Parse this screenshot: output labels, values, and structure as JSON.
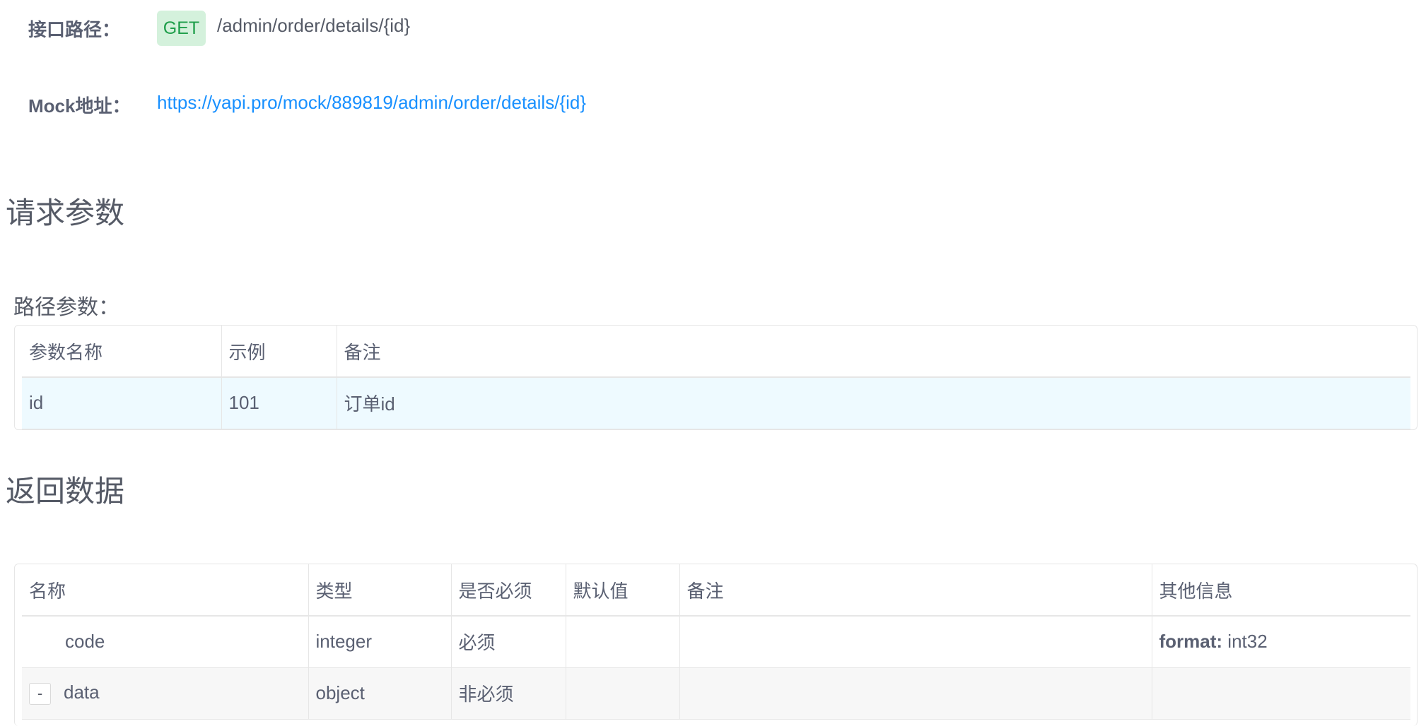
{
  "api": {
    "path_label": "接口路径：",
    "method": "GET",
    "path": "/admin/order/details/{id}",
    "mock_label": "Mock地址：",
    "mock_url": "https://yapi.pro/mock/889819/admin/order/details/{id}"
  },
  "request": {
    "title": "请求参数",
    "path_params_title": "路径参数：",
    "headers": [
      "参数名称",
      "示例",
      "备注"
    ],
    "rows": [
      {
        "name": "id",
        "example": "101",
        "note": "订单id"
      }
    ]
  },
  "response": {
    "title": "返回数据",
    "headers": [
      "名称",
      "类型",
      "是否必须",
      "默认值",
      "备注",
      "其他信息"
    ],
    "rows": [
      {
        "name": "code",
        "type": "integer",
        "required": "必须",
        "default": "",
        "note": "",
        "other_key": "format:",
        "other_val": " int32"
      },
      {
        "toggle": "-",
        "name": "data",
        "type": "object",
        "required": "非必须",
        "default": "",
        "note": "",
        "other_key": "",
        "other_val": ""
      }
    ]
  },
  "colors": {
    "method_bg": "#d4f1dc",
    "method_text": "#1e9e4a",
    "link": "#1890ff",
    "highlight_row": "#eefaff"
  }
}
